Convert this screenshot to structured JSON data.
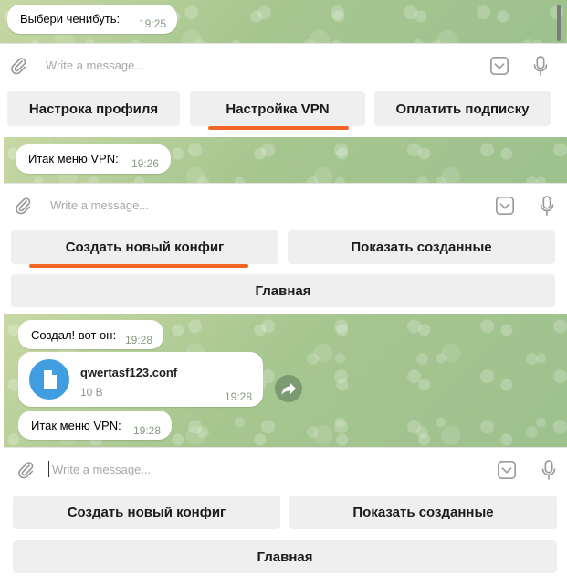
{
  "panel1": {
    "message": {
      "text": "Выбери ченибуть:",
      "time": "19:25"
    },
    "input": {
      "placeholder": "Write a message..."
    },
    "buttons": [
      "Настрока профиля",
      "Настройка VPN",
      "Оплатить подписку"
    ]
  },
  "panel2": {
    "message": {
      "text": "Итак меню VPN:",
      "time": "19:26"
    },
    "input": {
      "placeholder": "Write a message..."
    },
    "buttons": [
      "Создать новый конфиг",
      "Показать созданные",
      "Главная"
    ]
  },
  "panel3": {
    "messages": [
      {
        "text": "Создал! вот он:",
        "time": "19:28"
      },
      {
        "text": "Итак меню VPN:",
        "time": "19:28"
      }
    ],
    "file": {
      "name": "qwertasf123.conf",
      "size": "10 B",
      "time": "19:28"
    },
    "input": {
      "placeholder": "Write a message..."
    },
    "buttons": [
      "Создать новый конфиг",
      "Показать созданные",
      "Главная"
    ]
  },
  "colors": {
    "accent_underline": "#f26522",
    "file_icon": "#3f9de0",
    "chat_background": "#a9c592"
  },
  "icons": [
    "paperclip-icon",
    "emoji-keyboard-icon",
    "microphone-icon",
    "document-icon",
    "share-icon"
  ]
}
